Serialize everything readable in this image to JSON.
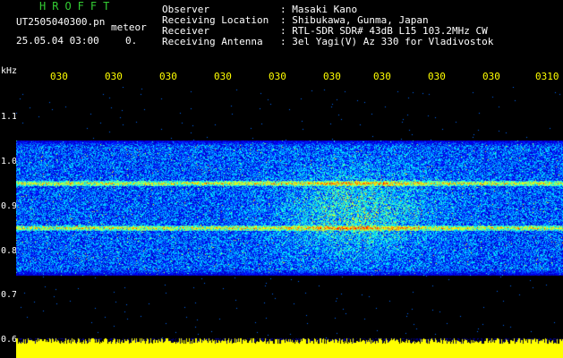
{
  "header": {
    "brand": "HROFFT",
    "brand_color": "#33cc33",
    "file_name": "UT2505040300.pn",
    "file_suffix": "meteor",
    "datetime": "25.05.04 03:00",
    "count": "0."
  },
  "info": [
    {
      "label": "Observer",
      "value": ": Masaki Kano"
    },
    {
      "label": "Receiving Location",
      "value": ": Shibukawa, Gunma, Japan"
    },
    {
      "label": "Receiver",
      "value": ": RTL-SDR SDR# 43dB L15 103.2MHz CW"
    },
    {
      "label": "Receiving Antenna",
      "value": ": 3el Yagi(V) Az 330 for Vladivostok"
    }
  ],
  "chart_data": {
    "type": "heatmap",
    "yunit": "kHz",
    "x_ticks": [
      "030",
      "030",
      "030",
      "030",
      "030",
      "030",
      "030",
      "030",
      "030",
      "0310"
    ],
    "y_ticks": [
      "1.1",
      "1.0",
      "0.9",
      "0.8",
      "0.7",
      "0.6"
    ],
    "ylim": [
      0.6,
      1.1
    ],
    "signal_bands_khz": [
      0.955,
      0.855
    ],
    "noise_band_khz": [
      0.75,
      1.05
    ],
    "colormap": [
      "#000033",
      "#0000ff",
      "#00ffff",
      "#ffff00",
      "#ff0000"
    ],
    "axis_text_color": "#ffff00"
  }
}
